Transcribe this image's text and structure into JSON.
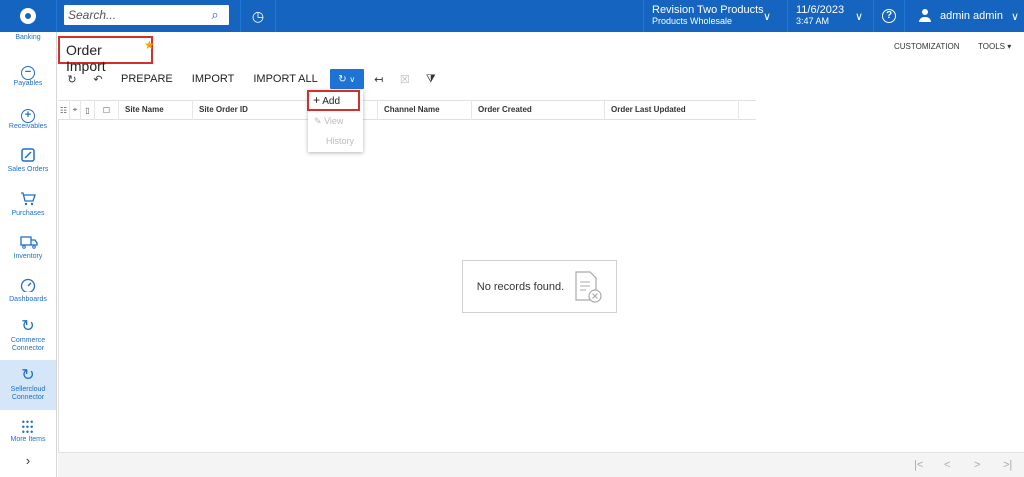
{
  "search": {
    "placeholder": "Search..."
  },
  "tenant": {
    "name": "Revision Two Products",
    "branch": "Products Wholesale"
  },
  "date": {
    "date": "11/6/2023",
    "time": "3:47 AM"
  },
  "user": {
    "name": "admin admin"
  },
  "sidebar": {
    "items": [
      {
        "label": "Banking",
        "icon": "bank-icon"
      },
      {
        "label": "Payables",
        "icon": "minus-circle-icon"
      },
      {
        "label": "Receivables",
        "icon": "plus-circle-icon"
      },
      {
        "label": "Sales Orders",
        "icon": "edit-icon"
      },
      {
        "label": "Purchases",
        "icon": "cart-icon"
      },
      {
        "label": "Inventory",
        "icon": "truck-icon"
      },
      {
        "label": "Dashboards",
        "icon": "gauge-icon"
      },
      {
        "label": "Commerce Connector",
        "icon": "sync-icon"
      },
      {
        "label": "Sellercloud Connector",
        "icon": "sync-icon"
      },
      {
        "label": "More Items",
        "icon": "grid-dots-icon"
      }
    ]
  },
  "page": {
    "title": "Order Import",
    "customization": "CUSTOMIZATION",
    "tools": "TOOLS"
  },
  "toolbar": {
    "prepare": "PREPARE",
    "import": "IMPORT",
    "import_all": "IMPORT ALL"
  },
  "grid": {
    "columns": [
      "Site Name",
      "Site Order ID",
      "Channel Name",
      "Order Created",
      "Order Last Updated"
    ],
    "empty_message": "No records found."
  },
  "dropdown": {
    "add": "Add",
    "view": "View",
    "history": "History"
  }
}
